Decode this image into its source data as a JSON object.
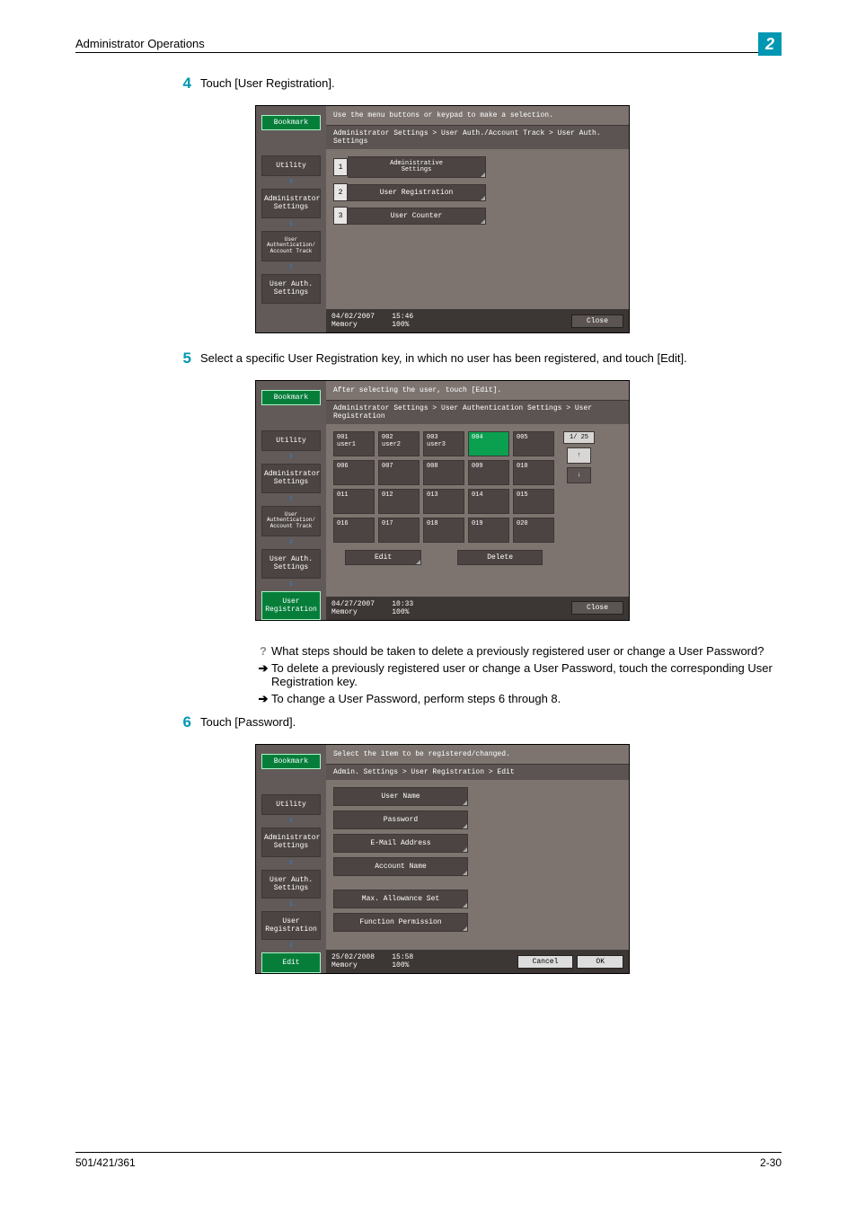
{
  "header": {
    "title": "Administrator Operations",
    "chapter": "2"
  },
  "steps": {
    "s4": {
      "num": "4",
      "text": "Touch [User Registration]."
    },
    "s5": {
      "num": "5",
      "text": "Select a specific User Registration key, in which no user has been registered, and touch [Edit]."
    },
    "s6": {
      "num": "6",
      "text": "Touch [Password]."
    }
  },
  "qa": {
    "q": "What steps should be taken to delete a previously registered user or change a User Password?",
    "a1": "To delete a previously registered user or change a User Password, touch the corresponding User Registration key.",
    "a2": "To change a User Password, perform steps 6 through 8."
  },
  "ss1": {
    "top": "Use the menu buttons or keypad to make a selection.",
    "path": "Administrator Settings > User Auth./Account Track > User Auth. Settings",
    "bookmark": "Bookmark",
    "side": [
      "Utility",
      "Administrator\nSettings",
      "User\nAuthentication/\nAccount Track",
      "User Auth.\nSettings"
    ],
    "menu": [
      {
        "n": "1",
        "t": "Administrative\nSettings"
      },
      {
        "n": "2",
        "t": "User Registration"
      },
      {
        "n": "3",
        "t": "User Counter"
      }
    ],
    "date": "04/02/2007",
    "time": "15:46",
    "mem": "Memory",
    "pct": "100%",
    "close": "Close"
  },
  "ss2": {
    "top": "After selecting the user, touch [Edit].",
    "path": "Administrator Settings > User Authentication Settings > User Registration",
    "bookmark": "Bookmark",
    "side": [
      "Utility",
      "Administrator\nSettings",
      "User\nAuthentication/\nAccount Track",
      "User Auth.\nSettings",
      "User\nRegistration"
    ],
    "cells": [
      {
        "i": "001",
        "n": "user1"
      },
      {
        "i": "002",
        "n": "user2"
      },
      {
        "i": "003",
        "n": "user3"
      },
      {
        "i": "004",
        "n": "",
        "sel": true
      },
      {
        "i": "005",
        "n": ""
      },
      {
        "i": "006",
        "n": ""
      },
      {
        "i": "007",
        "n": ""
      },
      {
        "i": "008",
        "n": ""
      },
      {
        "i": "009",
        "n": ""
      },
      {
        "i": "010",
        "n": ""
      },
      {
        "i": "011",
        "n": ""
      },
      {
        "i": "012",
        "n": ""
      },
      {
        "i": "013",
        "n": ""
      },
      {
        "i": "014",
        "n": ""
      },
      {
        "i": "015",
        "n": ""
      },
      {
        "i": "016",
        "n": ""
      },
      {
        "i": "017",
        "n": ""
      },
      {
        "i": "018",
        "n": ""
      },
      {
        "i": "019",
        "n": ""
      },
      {
        "i": "020",
        "n": ""
      }
    ],
    "pager": "1/ 25",
    "edit": "Edit",
    "delete": "Delete",
    "date": "04/27/2007",
    "time": "10:33",
    "close": "Close"
  },
  "ss3": {
    "top": "Select the item to be registered/changed.",
    "path": "Admin. Settings > User Registration > Edit",
    "bookmark": "Bookmark",
    "side": [
      "Utility",
      "Administrator\nSettings",
      "User Auth.\nSettings",
      "User\nRegistration",
      "Edit"
    ],
    "buttons": [
      "User Name",
      "Password",
      "E-Mail Address",
      "Account Name",
      "Max. Allowance Set",
      "Function Permission"
    ],
    "date": "25/02/2008",
    "time": "15:58",
    "cancel": "Cancel",
    "ok": "OK"
  },
  "footer": {
    "left": "501/421/361",
    "right": "2-30"
  }
}
